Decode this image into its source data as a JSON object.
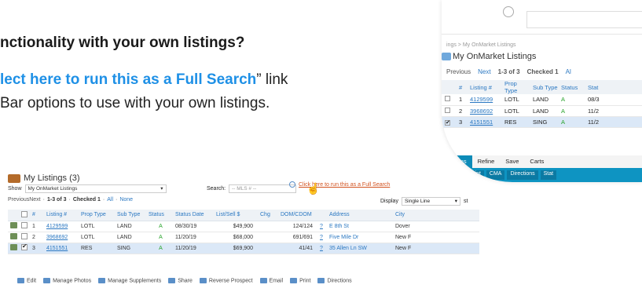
{
  "heading": {
    "question": "nctionality with your own listings?",
    "line1_prefix": "",
    "line1_highlight": "lect here to run this as a Full Search",
    "line1_suffix": "” link",
    "line2": "Bar options to use with your own listings."
  },
  "zoom": {
    "breadcrumb": "ings > My OnMarket Listings",
    "title": "My OnMarket Listings",
    "nav": {
      "previous": "Previous",
      "next": "Next",
      "range": "1-3 of 3",
      "checked": "Checked 1",
      "all": "Al"
    },
    "columns": [
      "#",
      "Listing #",
      "Prop Type",
      "Sub Type",
      "Status",
      "Stat"
    ],
    "rows": [
      {
        "num": "1",
        "listing": "4129599",
        "prop": "LOTL",
        "sub": "LAND",
        "status": "A",
        "date": "08/3",
        "checked": false
      },
      {
        "num": "2",
        "listing": "3968692",
        "prop": "LOTL",
        "sub": "LAND",
        "status": "A",
        "date": "11/2",
        "checked": false
      },
      {
        "num": "3",
        "listing": "4151551",
        "prop": "RES",
        "sub": "SING",
        "status": "A",
        "date": "11/2",
        "checked": true
      }
    ],
    "tabs": [
      "Actions",
      "Refine",
      "Save",
      "Carts"
    ],
    "buttons": [
      "Email",
      "Print",
      "CMA",
      "Directions",
      "Stat"
    ]
  },
  "shot": {
    "title": "My Listings (3)",
    "show_label": "Show",
    "show_value": "My OnMarket Listings",
    "search_label": "Search:",
    "search_placeholder": "-- MLS # --",
    "full_search": "Click here to run this as a Full Search",
    "nav": {
      "prev_next": "PreviousNext",
      "range": "1-3 of 3",
      "checked": "Checked 1",
      "all": "All",
      "none": "None"
    },
    "display_label": "Display",
    "display_value": "Single Line",
    "display_suffix": "st",
    "columns": [
      "#",
      "Listing #",
      "Prop Type",
      "Sub Type",
      "Status",
      "Status Date",
      "List/Sell $",
      "Chg",
      "DOM/CDOM",
      "Address",
      "City"
    ],
    "rows": [
      {
        "num": "1",
        "listing": "4129599",
        "prop": "LOTL",
        "sub": "LAND",
        "status": "A",
        "date": "08/30/19",
        "price": "$49,900",
        "dom": "124/124",
        "q": "?",
        "address": "E 8th St",
        "city": "Dover",
        "checked": false
      },
      {
        "num": "2",
        "listing": "3968692",
        "prop": "LOTL",
        "sub": "LAND",
        "status": "A",
        "date": "11/20/19",
        "price": "$68,000",
        "dom": "691/691",
        "q": "?",
        "address": "Five Mile Dr",
        "city": "New F",
        "checked": false
      },
      {
        "num": "3",
        "listing": "4151551",
        "prop": "RES",
        "sub": "SING",
        "status": "A",
        "date": "11/20/19",
        "price": "$69,900",
        "dom": "41/41",
        "q": "?",
        "address": "35 Allen Ln SW",
        "city": "New F",
        "checked": true
      }
    ],
    "actions": [
      "Edit",
      "Manage Photos",
      "Manage Supplements",
      "Share",
      "Reverse Prospect",
      "Email",
      "Print",
      "Directions"
    ]
  }
}
